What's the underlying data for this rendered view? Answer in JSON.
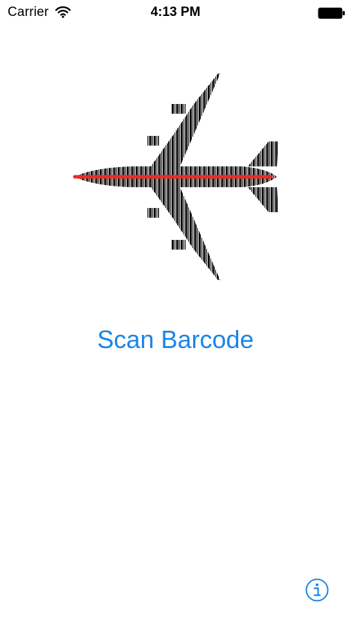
{
  "status_bar": {
    "carrier": "Carrier",
    "time": "4:13 PM",
    "wifi_icon": "wifi-icon",
    "battery_icon": "battery-icon"
  },
  "logo": {
    "icon": "barcode-airplane-icon",
    "scan_line_color": "#ee2b24"
  },
  "main": {
    "scan_button_label": "Scan Barcode"
  },
  "footer": {
    "info_icon": "info-icon"
  },
  "colors": {
    "accent": "#1a85e8",
    "background": "#ffffff",
    "text": "#000000"
  }
}
